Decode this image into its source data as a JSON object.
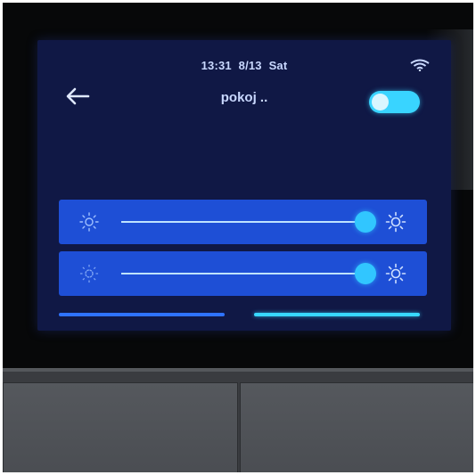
{
  "status_bar": {
    "time": "13:31",
    "date": "8/13",
    "weekday": "Sat",
    "wifi_icon": "wifi-icon"
  },
  "header": {
    "title": "pokoj ..",
    "back_icon": "arrow-left-icon",
    "power_toggle_on": true
  },
  "sliders": [
    {
      "min_icon": "brightness-low-icon",
      "max_icon": "brightness-high-icon",
      "level": 0.96
    },
    {
      "min_icon": "brightness-low-icon",
      "max_icon": "brightness-high-icon",
      "level": 0.96
    }
  ],
  "pager": {
    "pages": 2,
    "active_page": 2
  },
  "colors": {
    "screen_background": "#101845",
    "card": "#1e4fd6",
    "accent": "#39d4ff",
    "text": "#c9d8ff"
  }
}
